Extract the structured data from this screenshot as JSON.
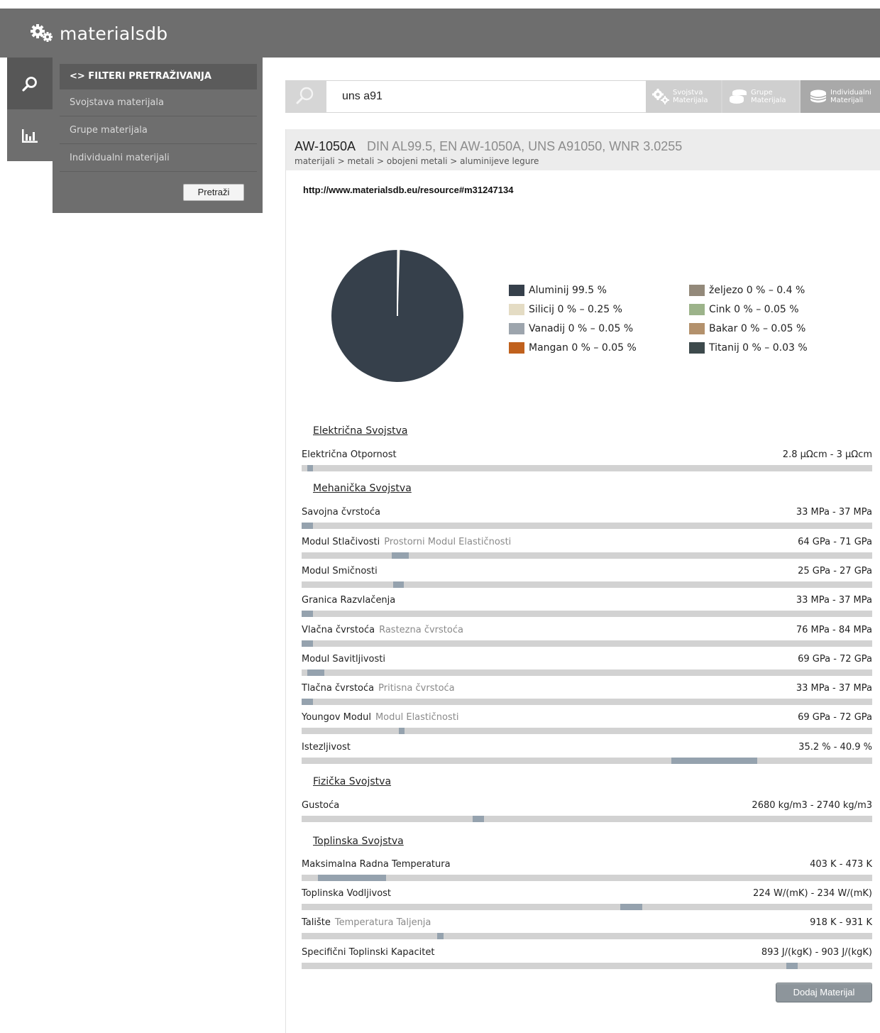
{
  "app": {
    "logo_text": "materialsdb"
  },
  "sidebar": {
    "tabs": [
      {
        "icon": "search-icon"
      },
      {
        "icon": "bar-chart-icon"
      }
    ],
    "filter_title": "<> FILTERI PRETRAŽIVANJA",
    "items": [
      {
        "label": "Svojstava materijala"
      },
      {
        "label": "Grupe materijala"
      },
      {
        "label": "Individualni materijali"
      }
    ],
    "search_button": "Pretraži"
  },
  "search": {
    "value": "uns a91",
    "tabs": [
      {
        "line1": "Svojstva",
        "line2": "Materijala",
        "icon": "gears-icon"
      },
      {
        "line1": "Grupe",
        "line2": "Materijala",
        "icon": "stack-icon"
      },
      {
        "line1": "Individualni",
        "line2": "Materijali",
        "icon": "stack-icon"
      }
    ]
  },
  "material": {
    "name": "AW-1050A",
    "synonyms": "DIN AL99.5, EN AW-1050A, UNS A91050, WNR 3.0255",
    "breadcrumb": "materijali > metali > obojeni metali > aluminijeve legure",
    "uri": "http://www.materialsdb.eu/resource#m31247134"
  },
  "composition": {
    "colors": {
      "aluminij": "#36404b",
      "silicij": "#e4dcc4",
      "vanadij": "#9da5ad",
      "mangan": "#c0611d",
      "zeljezo": "#93897a",
      "cink": "#9cb38a",
      "bakar": "#b3916c",
      "titanij": "#3d4a4c"
    },
    "legend": [
      {
        "label": "Aluminij 99.5 %",
        "color": "#36404b"
      },
      {
        "label": "Silicij 0 % – 0.25 %",
        "color": "#e4dcc4"
      },
      {
        "label": "Vanadij 0 % – 0.05 %",
        "color": "#9da5ad"
      },
      {
        "label": "Mangan 0 % – 0.05 %",
        "color": "#c0611d"
      },
      {
        "label": "željezo 0 % – 0.4 %",
        "color": "#93897a"
      },
      {
        "label": "Cink 0 % – 0.05 %",
        "color": "#9cb38a"
      },
      {
        "label": "Bakar 0 % – 0.05 %",
        "color": "#b3916c"
      },
      {
        "label": "Titanij 0 % – 0.03 %",
        "color": "#3d4a4c"
      }
    ],
    "pie_percent": {
      "aluminij": 99.5,
      "other": 0.5
    }
  },
  "properties": {
    "sections": [
      {
        "title": "Električna Svojstva"
      },
      {
        "title": "Mehanička Svojstva"
      },
      {
        "title": "Fizička Svojstva"
      },
      {
        "title": "Toplinska Svojstva"
      }
    ],
    "items": [
      {
        "name": "Električna Otpornost",
        "synonym": "",
        "value": "2.8 μΩcm - 3 μΩcm",
        "range": [
          0.01,
          0.02
        ]
      },
      {
        "name": "Savojna čvrstoća",
        "synonym": "",
        "value": "33 MPa - 37 MPa",
        "range": [
          0.0,
          0.02
        ]
      },
      {
        "name": "Modul Stlačivosti",
        "synonym": "Prostorni Modul Elastičnosti",
        "value": "64 GPa - 71 GPa",
        "range": [
          0.158,
          0.188
        ]
      },
      {
        "name": "Modul Smičnosti",
        "synonym": "",
        "value": "25 GPa - 27 GPa",
        "range": [
          0.16,
          0.179
        ]
      },
      {
        "name": "Granica Razvlačenja",
        "synonym": "",
        "value": "33 MPa - 37 MPa",
        "range": [
          0.0,
          0.02
        ]
      },
      {
        "name": "Vlačna čvrstoća",
        "synonym": "Rastezna čvrstoća",
        "value": "76 MPa - 84 MPa",
        "range": [
          0.0,
          0.02
        ]
      },
      {
        "name": "Modul Savitljivosti",
        "synonym": "",
        "value": "69 GPa - 72 GPa",
        "range": [
          0.01,
          0.04
        ]
      },
      {
        "name": "Tlačna čvrstoća",
        "synonym": "Pritisna čvrstoća",
        "value": "33 MPa - 37 MPa",
        "range": [
          0.0,
          0.02
        ]
      },
      {
        "name": "Youngov Modul",
        "synonym": "Modul Elastičnosti",
        "value": "69 GPa - 72 GPa",
        "range": [
          0.17,
          0.18
        ]
      },
      {
        "name": "Istezljivost",
        "synonym": "",
        "value": "35.2 % - 40.9 %",
        "range": [
          0.648,
          0.799
        ]
      },
      {
        "name": "Gustoća",
        "synonym": "",
        "value": "2680 kg/m3 - 2740 kg/m3",
        "range": [
          0.3,
          0.32
        ]
      },
      {
        "name": "Maksimalna Radna Temperatura",
        "synonym": "",
        "value": "403 K - 473 K",
        "range": [
          0.029,
          0.149
        ]
      },
      {
        "name": "Toplinska Vodljivost",
        "synonym": "",
        "value": "224 W/(mK) - 234 W/(mK)",
        "range": [
          0.559,
          0.598
        ]
      },
      {
        "name": "Talište",
        "synonym": "Temperatura Taljenja",
        "value": "918 K - 931 K",
        "range": [
          0.238,
          0.249
        ]
      },
      {
        "name": "Specifični Toplinski Kapacitet",
        "synonym": "",
        "value": "893 J/(kgK) - 903 J/(kgK)",
        "range": [
          0.85,
          0.87
        ]
      }
    ]
  },
  "actions": {
    "add_material": "Dodaj Materijal"
  }
}
